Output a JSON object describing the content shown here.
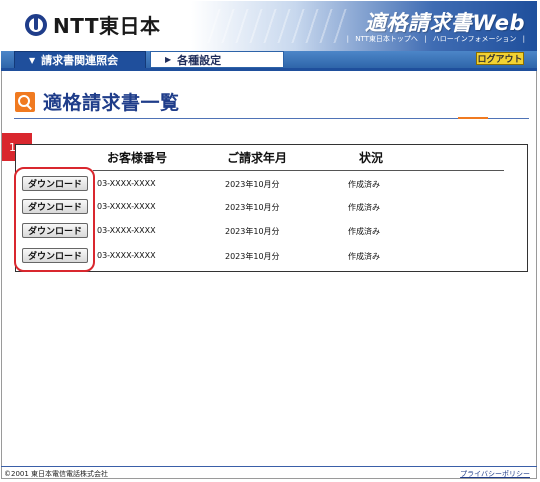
{
  "header": {
    "logo_text": "NTT東日本",
    "app_title": "適格請求書Web",
    "links": [
      "NTT東日本トップへ",
      "ハローインフォメーション"
    ],
    "logout_label": "ログアウト"
  },
  "nav": {
    "tabs": [
      {
        "label": "請求書関連照会",
        "active": true
      },
      {
        "label": "各種設定",
        "active": false
      }
    ]
  },
  "page": {
    "title": "適格請求書一覧",
    "step_number": "1"
  },
  "table": {
    "headers": {
      "customer_no": "お客様番号",
      "billing_month": "ご請求年月",
      "status": "状況"
    },
    "download_label": "ダウンロード",
    "rows": [
      {
        "customer_no": "03-XXXX-XXXX",
        "billing_month": "2023年10月分",
        "status": "作成済み"
      },
      {
        "customer_no": "03-XXXX-XXXX",
        "billing_month": "2023年10月分",
        "status": "作成済み"
      },
      {
        "customer_no": "03-XXXX-XXXX",
        "billing_month": "2023年10月分",
        "status": "作成済み"
      },
      {
        "customer_no": "03-XXXX-XXXX",
        "billing_month": "2023年10月分",
        "status": "作成済み"
      }
    ]
  },
  "footer": {
    "copyright": "©2001 東日本電信電話株式会社",
    "privacy_label": "プライバシーポリシー"
  },
  "colors": {
    "brand_blue": "#1f4f9c",
    "accent_orange": "#f07a20",
    "highlight_red": "#d9272e",
    "logout_yellow": "#f2d232"
  }
}
